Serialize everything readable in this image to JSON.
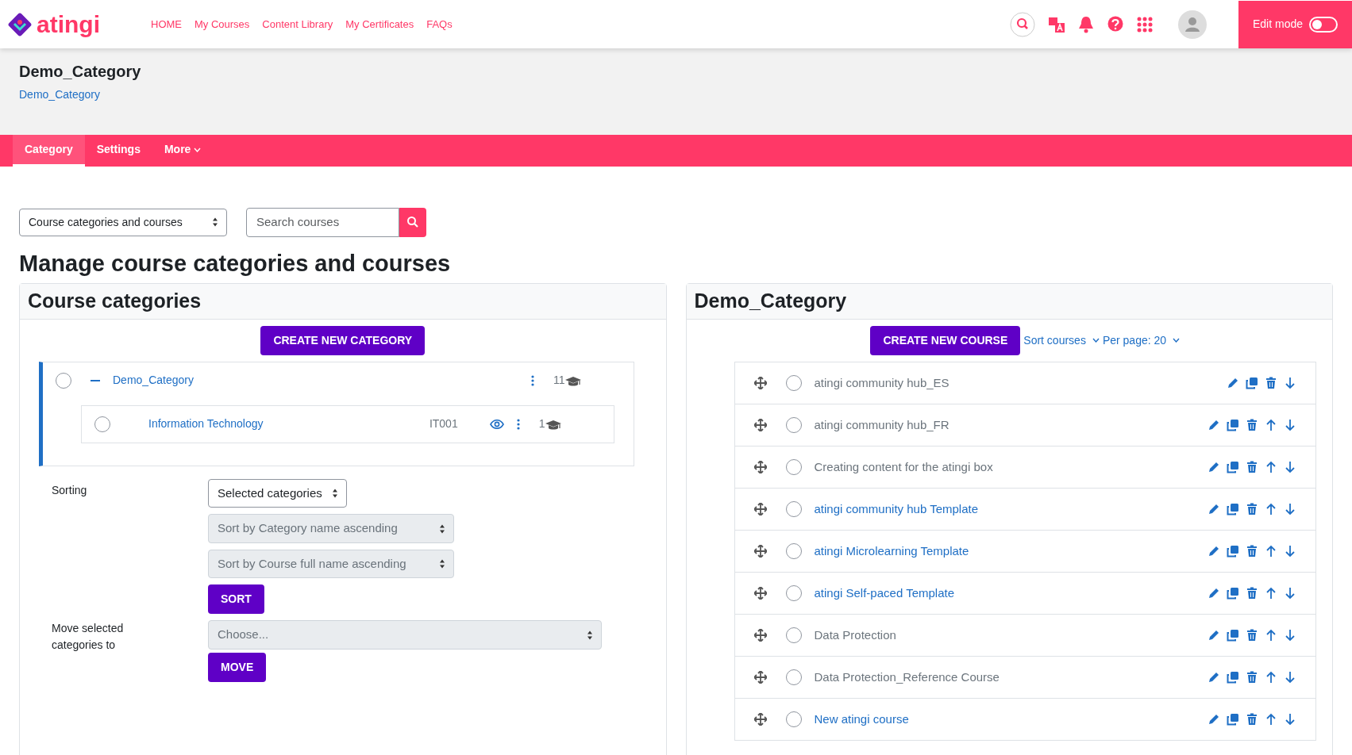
{
  "brand": {
    "name": "atingi"
  },
  "nav_links": [
    "HOME",
    "My Courses",
    "Content Library",
    "My Certificates",
    "FAQs"
  ],
  "edit_mode": {
    "label": "Edit mode",
    "on": false
  },
  "page_header": {
    "title": "Demo_Category",
    "breadcrumb": "Demo_Category"
  },
  "tabs": [
    {
      "label": "Category",
      "selected": true,
      "dropdown": false
    },
    {
      "label": "Settings",
      "selected": false,
      "dropdown": false
    },
    {
      "label": "More",
      "selected": false,
      "dropdown": true
    }
  ],
  "view_select": {
    "value": "Course categories and courses"
  },
  "search": {
    "placeholder": "Search courses"
  },
  "heading": "Manage course categories and courses",
  "categories_panel": {
    "title": "Course categories",
    "create_button": "CREATE NEW CATEGORY",
    "categories": [
      {
        "name": "Demo_Category",
        "expanded": true,
        "checked": false,
        "count": "11",
        "visible_icon": false,
        "children": [
          {
            "name": "Information Technology",
            "checked": false,
            "idnumber": "IT001",
            "count": "1",
            "visible_icon": true
          }
        ]
      }
    ],
    "sorting": {
      "label": "Sorting",
      "scope": "Selected categories",
      "category_sort": "Sort by Category name ascending",
      "course_sort": "Sort by Course full name ascending",
      "button": "SORT"
    },
    "move": {
      "label": "Move selected categories to",
      "placeholder": "Choose...",
      "button": "MOVE"
    }
  },
  "courses_panel": {
    "title": "Demo_Category",
    "create_button": "CREATE NEW COURSE",
    "sort_link": "Sort courses",
    "per_page": "Per page: 20",
    "courses": [
      {
        "name": "atingi community hub_ES",
        "visible": false,
        "checked": false,
        "move_up": false
      },
      {
        "name": "atingi community hub_FR",
        "visible": false,
        "checked": false,
        "move_up": true
      },
      {
        "name": "Creating content for the atingi box",
        "visible": false,
        "checked": false,
        "move_up": true
      },
      {
        "name": "atingi community hub Template",
        "visible": true,
        "checked": false,
        "move_up": true
      },
      {
        "name": "atingi Microlearning Template",
        "visible": true,
        "checked": false,
        "move_up": true
      },
      {
        "name": "atingi Self-paced Template",
        "visible": true,
        "checked": false,
        "move_up": true
      },
      {
        "name": "Data Protection",
        "visible": false,
        "checked": false,
        "move_up": true
      },
      {
        "name": "Data Protection_Reference Course",
        "visible": false,
        "checked": false,
        "move_up": true
      },
      {
        "name": "New atingi course",
        "visible": true,
        "checked": false,
        "move_up": true
      }
    ]
  }
}
